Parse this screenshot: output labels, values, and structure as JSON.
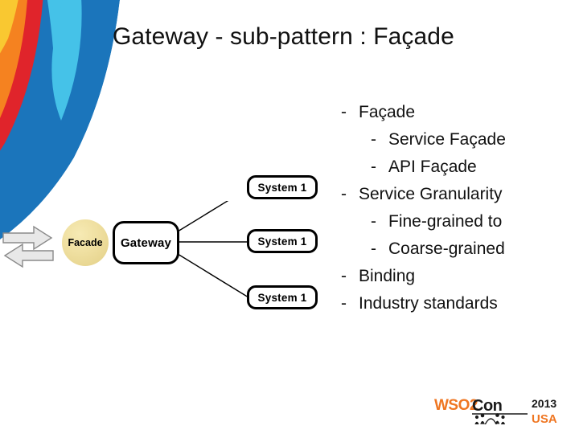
{
  "slide": {
    "title": "Gateway - sub-pattern : Façade",
    "background_color": "#ffffff"
  },
  "bullets": [
    {
      "level": 1,
      "dash": "-",
      "text": "Façade"
    },
    {
      "level": 2,
      "dash": "-",
      "text": "Service Façade"
    },
    {
      "level": 2,
      "dash": "-",
      "text": "API Façade"
    },
    {
      "level": 1,
      "dash": "-",
      "text": "Service Granularity"
    },
    {
      "level": 2,
      "dash": "-",
      "text": "Fine-grained to"
    },
    {
      "level": 2,
      "dash": "-",
      "text": "Coarse-grained"
    },
    {
      "level": 1,
      "dash": "-",
      "text": "Binding"
    },
    {
      "level": 1,
      "dash": "-",
      "text": "Industry standards"
    }
  ],
  "diagram": {
    "facade_label": "Facade",
    "gateway_label": "Gateway",
    "systems": [
      {
        "label": "System 1"
      },
      {
        "label": "System 1"
      },
      {
        "label": "System 1"
      }
    ],
    "colors": {
      "facade_fill": "#efdfa0",
      "facade_border": "#b9a45a",
      "node_border": "#000000",
      "connector": "#000000"
    }
  },
  "arrows": {
    "right_arrow_label": "right-arrow",
    "left_arrow_label": "left-arrow",
    "fill": "#e8e8e8",
    "stroke": "#808080"
  },
  "logo": {
    "wso2": "WSO2",
    "con": "Con",
    "year": "2013",
    "country": "USA",
    "orange": "#ef7622",
    "dark": "#1a1a1a"
  },
  "decoration": {
    "yellow": "#f9c831",
    "orange": "#f58220",
    "red": "#e0242b",
    "blue_dark": "#1b75bb",
    "blue_light": "#45c2e8"
  }
}
